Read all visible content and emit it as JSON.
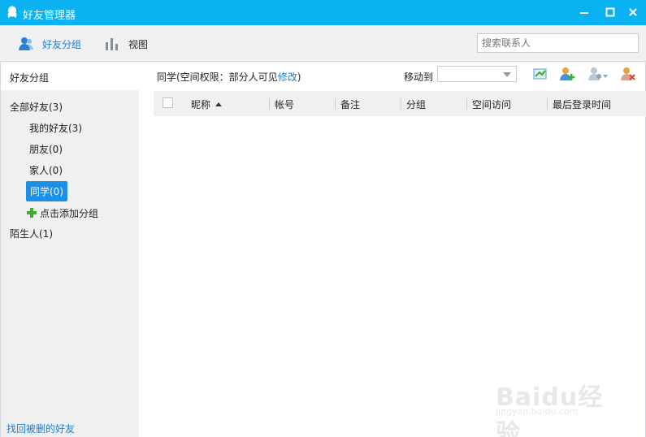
{
  "window": {
    "title": "好友管理器"
  },
  "toolbar": {
    "groups_label": "好友分组",
    "view_label": "视图",
    "search_placeholder": "搜索联系人"
  },
  "sidebar": {
    "header": "好友分组",
    "all": "全部好友(3)",
    "groups": [
      "我的好友(3)",
      "朋友(0)",
      "家人(0)"
    ],
    "selected": "同学(0)",
    "add_group": "点击添加分组",
    "strangers": "陌生人(1)",
    "recover": "找回被删的好友"
  },
  "main": {
    "crumb_prefix": "同学(空间权限：部分人可见",
    "crumb_link": "修改",
    "crumb_suffix": ")",
    "move_to": "移动到",
    "columns": [
      "昵称",
      "帐号",
      "备注",
      "分组",
      "空间访问",
      "最后登录时间"
    ]
  },
  "watermark": {
    "brand": "Baidu经验",
    "url": "jingyan.baidu.com"
  },
  "colors": {
    "accent": "#0bb2f2",
    "selected": "#1c8fe6",
    "link": "#1a7fd4"
  }
}
